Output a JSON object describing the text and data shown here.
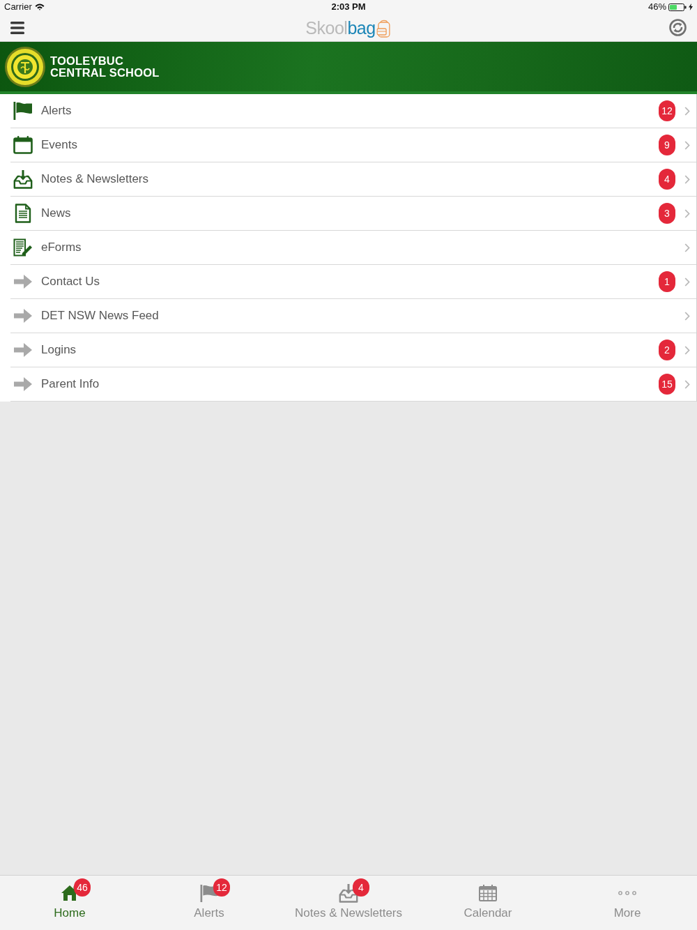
{
  "status_bar": {
    "carrier": "Carrier",
    "time": "2:03 PM",
    "battery": "46%"
  },
  "nav_bar": {
    "logo": {
      "part_1": "Skool",
      "part_2": "bag"
    }
  },
  "school_banner": {
    "name_lines": [
      "TOOLEYBUC",
      "CENTRAL SCHOOL"
    ]
  },
  "menu_items": [
    {
      "label": "Alerts",
      "kind": "flag",
      "badge": "12"
    },
    {
      "label": "Events",
      "kind": "calendar",
      "badge": "9"
    },
    {
      "label": "Notes & Newsletters",
      "kind": "inbox",
      "badge": "4"
    },
    {
      "label": "News",
      "kind": "document",
      "badge": "3"
    },
    {
      "label": "eForms",
      "kind": "form"
    },
    {
      "label": "Contact Us",
      "kind": "link",
      "badge": "1"
    },
    {
      "label": "DET NSW News Feed",
      "kind": "link"
    },
    {
      "label": "Logins",
      "kind": "link",
      "badge": "2"
    },
    {
      "label": "Parent Info",
      "kind": "link",
      "badge": "15"
    }
  ],
  "tab_bar": [
    {
      "label": "Home",
      "kind": "home",
      "badge": "46",
      "selected": true
    },
    {
      "label": "Alerts",
      "kind": "flag",
      "badge": "12",
      "selected": false
    },
    {
      "label": "Notes & Newsletters",
      "kind": "inbox",
      "badge": "4",
      "selected": false
    },
    {
      "label": "Calendar",
      "kind": "calendar",
      "selected": false
    },
    {
      "label": "More",
      "kind": "more",
      "selected": false
    }
  ]
}
